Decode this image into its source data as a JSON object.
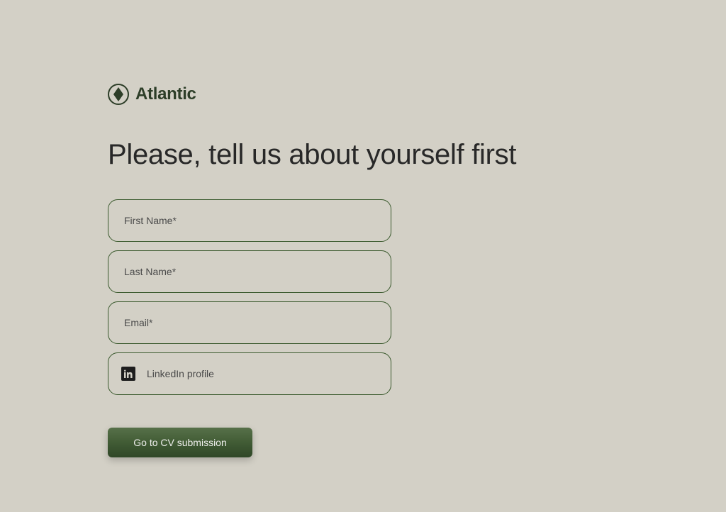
{
  "brand": {
    "name": "Atlantic"
  },
  "heading": "Please, tell us about yourself first",
  "fields": {
    "first_name": {
      "placeholder": "First Name*"
    },
    "last_name": {
      "placeholder": "Last Name*"
    },
    "email": {
      "placeholder": "Email*"
    },
    "linkedin": {
      "placeholder": "LinkedIn profile"
    }
  },
  "submit": {
    "label": "Go to CV submission"
  }
}
